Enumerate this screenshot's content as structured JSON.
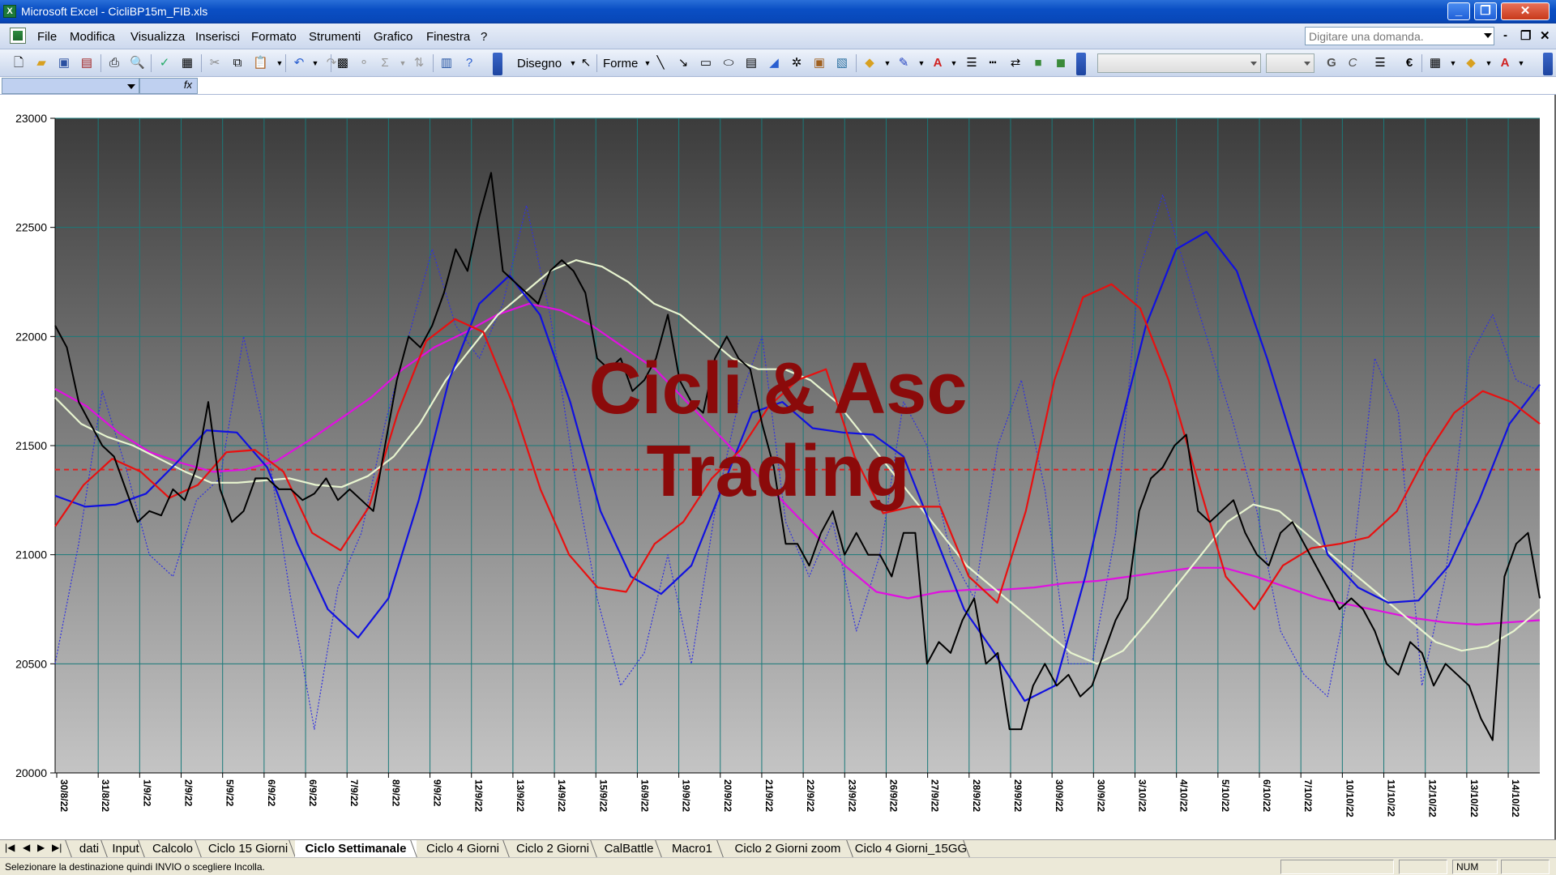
{
  "window": {
    "title": "Microsoft Excel - CicliBP15m_FIB.xls",
    "app_icon": "X",
    "controls": [
      "_",
      "❐",
      "✕"
    ]
  },
  "menubar": {
    "items": [
      "File",
      "Modifica",
      "Visualizza",
      "Inserisci",
      "Formato",
      "Strumenti",
      "Grafico",
      "Finestra",
      "?"
    ],
    "ask_placeholder": "Digitare una domanda.",
    "doc_controls": [
      "-",
      "❐",
      "✕"
    ]
  },
  "toolbar": {
    "draw_label": "Disegno",
    "shapes_label": "Forme",
    "bold_label": "G",
    "italic_label": "C",
    "euro_symbol": "€",
    "sigma_symbol": "Σ"
  },
  "formula_bar": {
    "fx_label": "fx"
  },
  "chart_data": {
    "type": "line",
    "watermark": [
      "Cicli & Asc",
      "Trading"
    ],
    "ylim": [
      20000,
      23000
    ],
    "y_ticks": [
      20000,
      20500,
      21000,
      21500,
      22000,
      22500,
      23000
    ],
    "x_tick_labels": [
      "30/8/22",
      "31/8/22",
      "1/9/22",
      "2/9/22",
      "5/9/22",
      "6/9/22",
      "6/9/22",
      "7/9/22",
      "8/9/22",
      "9/9/22",
      "12/9/22",
      "13/9/22",
      "14/9/22",
      "15/9/22",
      "16/9/22",
      "19/9/22",
      "20/9/22",
      "21/9/22",
      "22/9/22",
      "23/9/22",
      "26/9/22",
      "27/9/22",
      "28/9/22",
      "29/9/22",
      "30/9/22",
      "30/9/22",
      "3/10/22",
      "4/10/22",
      "5/10/22",
      "6/10/22",
      "7/10/22",
      "10/10/22",
      "11/10/22",
      "12/10/22",
      "13/10/22",
      "14/10/22"
    ],
    "reference_line": 21390,
    "grid": true,
    "colors": {
      "price": "#000000",
      "blue_cycle": "#1010e0",
      "red_cycle": "#e81010",
      "magenta_ma": "#e010e0",
      "white_ma": "#e8f5d0",
      "dotted_osc": "#3030e0",
      "reference": "#e02020"
    },
    "series": [
      {
        "key": "price",
        "values": [
          22050,
          21950,
          21700,
          21600,
          21500,
          21450,
          21300,
          21150,
          21200,
          21180,
          21300,
          21250,
          21400,
          21700,
          21300,
          21150,
          21200,
          21350,
          21350,
          21300,
          21300,
          21250,
          21280,
          21350,
          21250,
          21300,
          21250,
          21200,
          21500,
          21800,
          22000,
          21950,
          22050,
          22200,
          22400,
          22300,
          22550,
          22750,
          22300,
          22250,
          22200,
          22150,
          22300,
          22350,
          22300,
          22200,
          21900,
          21850,
          21900,
          21750,
          21800,
          21900,
          22100,
          21800,
          21700,
          21650,
          21900,
          22000,
          21900,
          21850,
          21600,
          21400,
          21050,
          21050,
          20950,
          21100,
          21200,
          21000,
          21100,
          21000,
          21000,
          20900,
          21100,
          21100,
          20500,
          20600,
          20550,
          20700,
          20800,
          20500,
          20550,
          20200,
          20200,
          20400,
          20500,
          20400,
          20450,
          20350,
          20400,
          20550,
          20700,
          20800,
          21200,
          21350,
          21400,
          21500,
          21550,
          21200,
          21150,
          21200,
          21250,
          21100,
          21000,
          20950,
          21100,
          21150,
          21050,
          20950,
          20850,
          20750,
          20800,
          20750,
          20650,
          20500,
          20450,
          20600,
          20550,
          20400,
          20500,
          20450,
          20400,
          20250,
          20150,
          20900,
          21050,
          21100,
          20800
        ]
      },
      {
        "key": "white_ma",
        "values": [
          21720,
          21600,
          21540,
          21500,
          21440,
          21380,
          21330,
          21330,
          21340,
          21350,
          21320,
          21310,
          21360,
          21450,
          21600,
          21800,
          21950,
          22100,
          22200,
          22300,
          22350,
          22320,
          22250,
          22150,
          22100,
          22000,
          21900,
          21850,
          21850,
          21800,
          21700,
          21550,
          21400,
          21250,
          21100,
          20950,
          20850,
          20750,
          20650,
          20550,
          20500,
          20560,
          20700,
          20850,
          21000,
          21150,
          21230,
          21200,
          21100,
          21000,
          20900,
          20800,
          20700,
          20600,
          20560,
          20580,
          20650,
          20750
        ]
      },
      {
        "key": "magenta_ma",
        "values": [
          21760,
          21680,
          21560,
          21470,
          21420,
          21380,
          21390,
          21430,
          21520,
          21620,
          21720,
          21850,
          21950,
          22020,
          22100,
          22150,
          22120,
          22050,
          21950,
          21850,
          21700,
          21550,
          21400,
          21250,
          21100,
          20950,
          20830,
          20800,
          20830,
          20840,
          20840,
          20850,
          20870,
          20880,
          20900,
          20920,
          20940,
          20940,
          20900,
          20850,
          20800,
          20770,
          20740,
          20710,
          20690,
          20680,
          20690,
          20700
        ]
      },
      {
        "key": "blue_cycle",
        "values": [
          21270,
          21220,
          21230,
          21280,
          21420,
          21570,
          21560,
          21400,
          21050,
          20750,
          20620,
          20800,
          21250,
          21800,
          22150,
          22280,
          22100,
          21700,
          21200,
          20900,
          20820,
          20950,
          21300,
          21650,
          21700,
          21580,
          21560,
          21550,
          21450,
          21100,
          20750,
          20550,
          20330,
          20400,
          20900,
          21500,
          22050,
          22400,
          22480,
          22300,
          21900,
          21450,
          21000,
          20850,
          20780,
          20790,
          20950,
          21250,
          21600,
          21780
        ]
      },
      {
        "key": "red_cycle",
        "values": [
          21130,
          21320,
          21440,
          21380,
          21260,
          21320,
          21470,
          21480,
          21380,
          21100,
          21020,
          21220,
          21650,
          21980,
          22080,
          22020,
          21700,
          21300,
          21000,
          20850,
          20830,
          21050,
          21150,
          21350,
          21480,
          21680,
          21800,
          21850,
          21450,
          21190,
          21220,
          21220,
          20900,
          20780,
          21200,
          21800,
          22180,
          22240,
          22130,
          21800,
          21350,
          20900,
          20750,
          20950,
          21030,
          21050,
          21080,
          21200,
          21450,
          21650,
          21750,
          21700,
          21600
        ]
      },
      {
        "key": "dotted_osc",
        "values": [
          20500,
          21050,
          21750,
          21400,
          21000,
          20900,
          21250,
          21350,
          22000,
          21500,
          20800,
          20200,
          20850,
          21100,
          21600,
          22000,
          22400,
          22050,
          21900,
          22150,
          22600,
          22100,
          21400,
          20800,
          20400,
          20550,
          21000,
          20500,
          21200,
          21700,
          22000,
          21150,
          20900,
          21150,
          20650,
          21000,
          21700,
          21500,
          21000,
          20800,
          21500,
          21800,
          21300,
          20500,
          20500,
          21100,
          22300,
          22650,
          22300,
          21950,
          21600,
          21200,
          20650,
          20450,
          20350,
          20900,
          21900,
          21650,
          20400,
          20900,
          21900,
          22100,
          21800,
          21750
        ]
      }
    ]
  },
  "tabs": {
    "nav": [
      "|◀",
      "◀",
      "▶",
      "▶|"
    ],
    "items": [
      "dati",
      "Input",
      "Calcolo",
      "Ciclo 15 Giorni",
      "Ciclo Settimanale",
      "Ciclo 4 Giorni",
      "Ciclo 2 Giorni",
      "CalBattle",
      "Macro1",
      "Ciclo 2 Giorni zoom",
      "Ciclo 4 Giorni_15GG"
    ],
    "active_index": 4
  },
  "status": {
    "message": "Selezionare la destinazione quindi INVIO o scegliere Incolla.",
    "num": "NUM"
  }
}
